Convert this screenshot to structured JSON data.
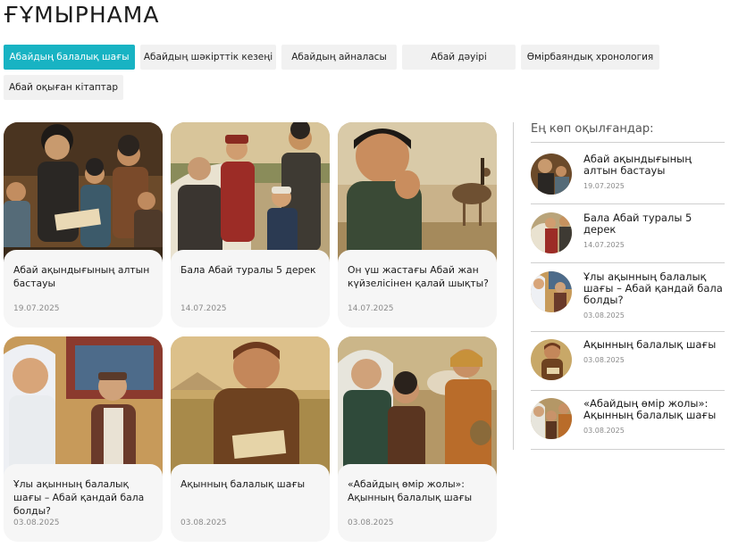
{
  "page": {
    "title": "ҒҰМЫРНАМА"
  },
  "tabs": [
    {
      "label": "Абайдың балалық шағы",
      "active": true
    },
    {
      "label": "Абайдың шәкірттік кезеңі",
      "active": false
    },
    {
      "label": "Абайдың айналасы",
      "active": false
    },
    {
      "label": "Абай дәуірі",
      "active": false
    },
    {
      "label": "Өмірбаяндық хронология",
      "active": false
    },
    {
      "label": "Абай оқыған кітаптар",
      "active": false
    }
  ],
  "cards": [
    {
      "title": "Абай ақындығының алтын бастауы",
      "date": "19.07.2025"
    },
    {
      "title": "Бала Абай туралы 5 дерек",
      "date": "14.07.2025"
    },
    {
      "title": "Он үш жастағы Абай жан күйзелісінен қалай шықты?",
      "date": "14.07.2025"
    },
    {
      "title": "Ұлы ақынның балалық шағы – Абай қандай бала болды?",
      "date": "03.08.2025"
    },
    {
      "title": "Ақынның балалық шағы",
      "date": "03.08.2025"
    },
    {
      "title": "«Абайдың өмір жолы»: Ақынның балалық шағы",
      "date": "03.08.2025"
    }
  ],
  "sidebar": {
    "title": "Ең көп оқылғандар:",
    "items": [
      {
        "title": "Абай ақындығының алтын бастауы",
        "date": "19.07.2025"
      },
      {
        "title": "Бала Абай туралы 5 дерек",
        "date": "14.07.2025"
      },
      {
        "title": "Ұлы ақынның балалық шағы – Абай қандай бала болды?",
        "date": "03.08.2025"
      },
      {
        "title": "Ақынның балалық шағы",
        "date": "03.08.2025"
      },
      {
        "title": "«Абайдың өмір жолы»: Ақынның балалық шағы",
        "date": "03.08.2025"
      }
    ]
  },
  "colors": {
    "accent": "#18b3c3",
    "tab_bg": "#f1f1f1",
    "card_bg": "#f6f6f6",
    "date": "#8a8a8a"
  }
}
